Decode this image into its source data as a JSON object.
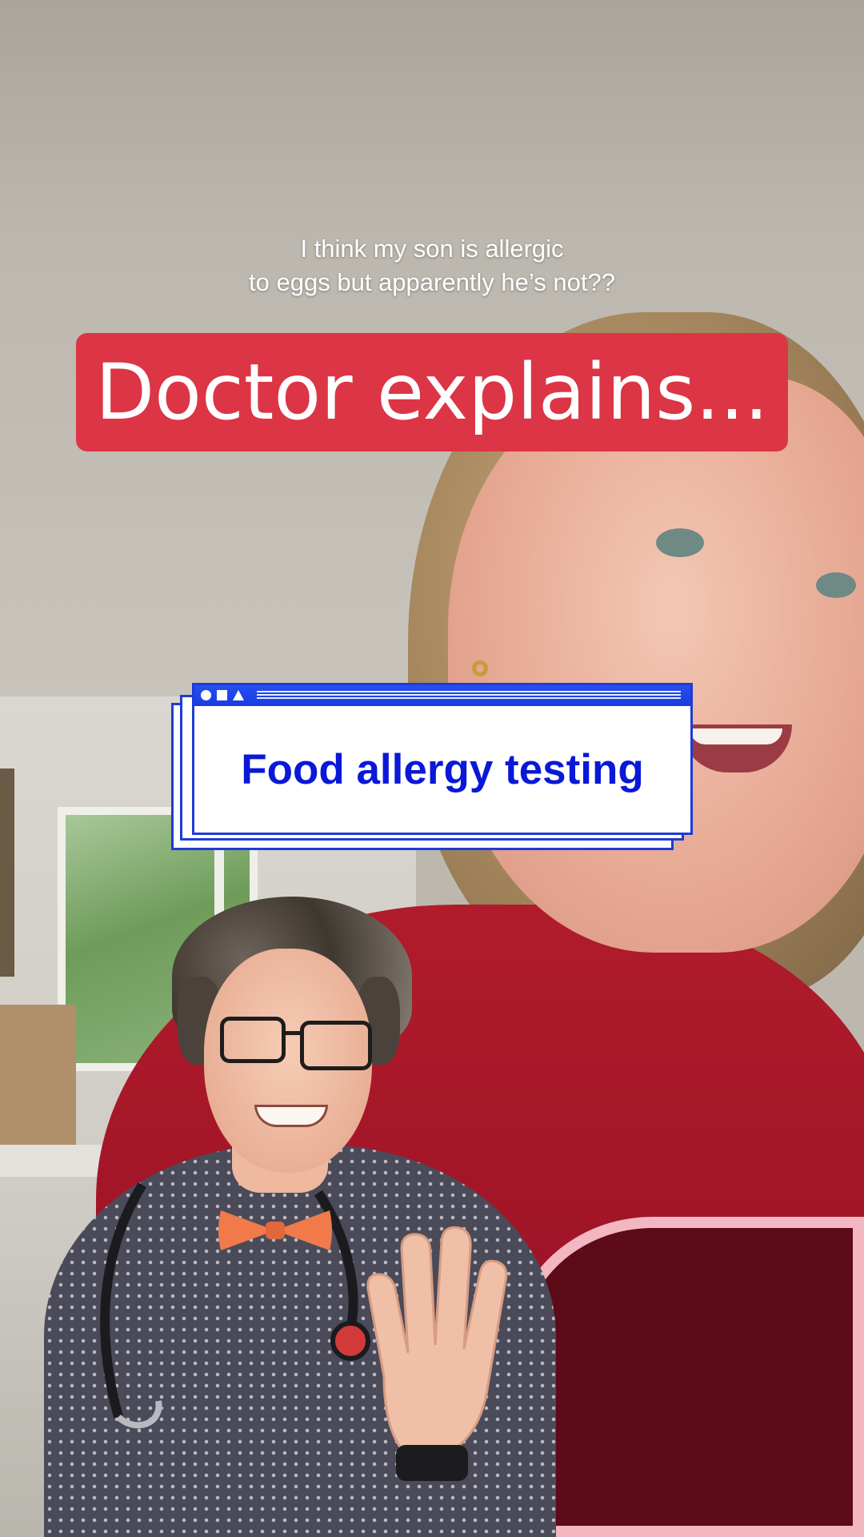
{
  "video": {
    "caption_lines": [
      "I think my son is allergic",
      "to eggs but apparently he’s not??"
    ],
    "headline": "Doctor explains...",
    "card": {
      "title": "Food allergy testing",
      "controls": [
        "circle-icon",
        "square-icon",
        "triangle-icon"
      ]
    }
  },
  "colors": {
    "headline_bg": "#dc3545",
    "card_text": "#0a18d8",
    "card_border": "#1f3bd6"
  }
}
